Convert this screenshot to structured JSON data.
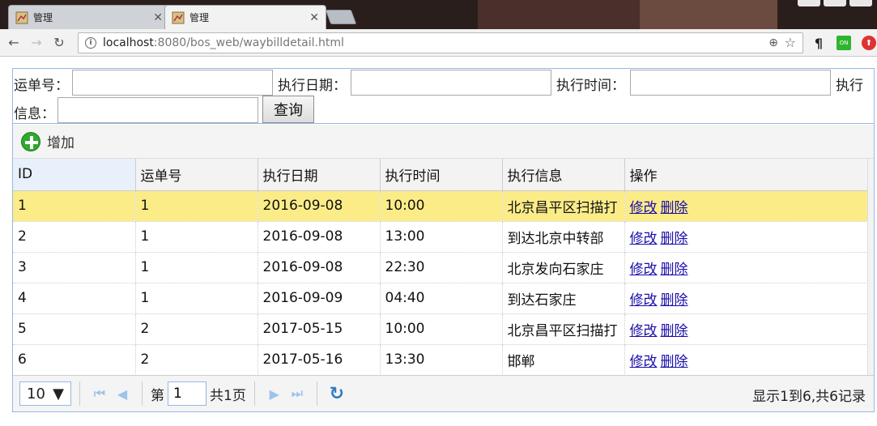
{
  "browser": {
    "tabs": [
      {
        "title": "管理"
      },
      {
        "title": "管理"
      }
    ],
    "url_host": "localhost",
    "url_rest": ":8080/bos_web/waybilldetail.html"
  },
  "search": {
    "waybill_label": "运单号：",
    "exec_date_label": "执行日期：",
    "exec_time_label": "执行时间：",
    "exec_info_label_part1": "执行",
    "exec_info_label_part2": "信息：",
    "query_button": "查询"
  },
  "toolbar": {
    "add_label": "增加"
  },
  "grid": {
    "columns": [
      "ID",
      "运单号",
      "执行日期",
      "执行时间",
      "执行信息",
      "操作"
    ],
    "rows": [
      {
        "id": "1",
        "waybill": "1",
        "date": "2016-09-08",
        "time": "10:00",
        "info": "北京昌平区扫描打"
      },
      {
        "id": "2",
        "waybill": "1",
        "date": "2016-09-08",
        "time": "13:00",
        "info": "到达北京中转部"
      },
      {
        "id": "3",
        "waybill": "1",
        "date": "2016-09-08",
        "time": "22:30",
        "info": "北京发向石家庄"
      },
      {
        "id": "4",
        "waybill": "1",
        "date": "2016-09-09",
        "time": "04:40",
        "info": "到达石家庄"
      },
      {
        "id": "5",
        "waybill": "2",
        "date": "2017-05-15",
        "time": "10:00",
        "info": "北京昌平区扫描打"
      },
      {
        "id": "6",
        "waybill": "2",
        "date": "2017-05-16",
        "time": "13:30",
        "info": "邯郸"
      }
    ],
    "edit_label": "修改",
    "delete_label": "删除",
    "selected_row": 0
  },
  "pager": {
    "page_size": "10",
    "page_prefix": "第",
    "page_number": "1",
    "page_total": "共1页",
    "info": "显示1到6,共6记录"
  },
  "colors": {
    "selected_row": "#fbec88",
    "panel_border": "#95b8e7",
    "link": "#1a0dab"
  }
}
